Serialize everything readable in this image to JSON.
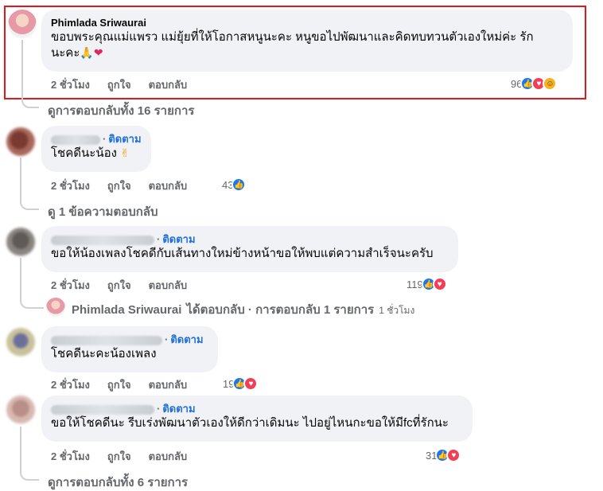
{
  "comments": [
    {
      "author": "Phimlada Sriwaurai",
      "text_line1": "ขอบพระคุณแม่แพรว แม่ยุ้ยที่ให้โอกาสหนูนะคะ หนูขอไปพัฒนาและคิดทบทวนตัวเองใหม่ค่ะ รัก",
      "text_line2": "นะคะ",
      "emoji": "🙏❤",
      "time": "2 ชั่วโมง",
      "like": "ถูกใจ",
      "reply": "ตอบกลับ",
      "reaction_count": "96",
      "reaction_types": [
        "like",
        "love",
        "haha"
      ],
      "view_replies": "ดูการตอบกลับทั้ง 16 รายการ"
    },
    {
      "follow": "ติดตาม",
      "text": "โชคดีนะน้อง",
      "emoji": "✌",
      "time": "2 ชั่วโมง",
      "like": "ถูกใจ",
      "reply": "ตอบกลับ",
      "reaction_count": "43",
      "reaction_types": [
        "like"
      ],
      "view_replies": "ดู 1 ข้อความตอบกลับ"
    },
    {
      "follow": "ติดตาม",
      "text": "ขอให้น้องเพลงโชคดีกับเส้นทางใหม่ข้างหน้าขอให้พบแต่ความสำเร็จนะครับ",
      "time": "2 ชั่วโมง",
      "like": "ถูกใจ",
      "reply": "ตอบกลับ",
      "reaction_count": "119",
      "reaction_types": [
        "like",
        "love"
      ],
      "reply_summary_name": "Phimlada Sriwaurai",
      "reply_summary_text": "ได้ตอบกลับ · การตอบกลับ 1 รายการ",
      "reply_summary_ago": "1 ชั่วโมง"
    },
    {
      "follow": "ติดตาม",
      "text": "โชคดีนะคะน้องเพลง",
      "time": "2 ชั่วโมง",
      "like": "ถูกใจ",
      "reply": "ตอบกลับ",
      "reaction_count": "19",
      "reaction_types": [
        "like",
        "love"
      ]
    },
    {
      "follow": "ติดตาม",
      "text": "ขอให้โชคดีนะ รีบเร่งพัฒนาตัวเองให้ดีกว่าเดิมนะ ไปอยู่ไหนกะขอให้มีfcที่รักนะ",
      "time": "2 ชั่วโมง",
      "like": "ถูกใจ",
      "reply": "ตอบกลับ",
      "reaction_count": "31",
      "reaction_types": [
        "like",
        "love"
      ],
      "view_replies": "ดูการตอบกลับทั้ง 6 รายการ"
    }
  ],
  "colors": {
    "highlight": "#e0171d",
    "link": "#216fdb",
    "bubble": "#f0f2f5",
    "muted": "#65676b"
  }
}
